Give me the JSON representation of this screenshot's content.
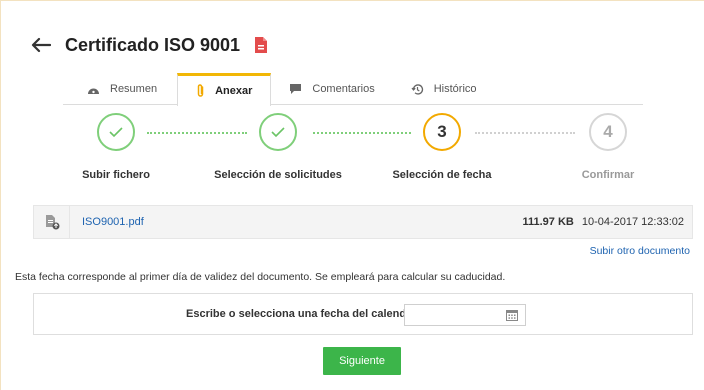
{
  "header": {
    "title": "Certificado ISO 9001",
    "back_icon": "arrow-left-icon",
    "doc_icon": "pdf-file-icon"
  },
  "tabs": [
    {
      "label": "Resumen",
      "icon": "dashboard-icon",
      "active": false
    },
    {
      "label": "Anexar",
      "icon": "paperclip-icon",
      "active": true
    },
    {
      "label": "Comentarios",
      "icon": "comment-icon",
      "active": false
    },
    {
      "label": "Histórico",
      "icon": "history-icon",
      "active": false
    }
  ],
  "stepper": {
    "steps": [
      {
        "number": "1",
        "label": "Subir fichero",
        "state": "done"
      },
      {
        "number": "2",
        "label": "Selección de solicitudes",
        "state": "done"
      },
      {
        "number": "3",
        "label": "Selección de fecha",
        "state": "current"
      },
      {
        "number": "4",
        "label": "Confirmar",
        "state": "future"
      }
    ]
  },
  "file": {
    "name": "ISO9001.pdf",
    "size": "111.97 KB",
    "date": "10-04-2017 12:33:02",
    "icon": "file-upload-icon"
  },
  "upload_other_label": "Subir otro documento",
  "info_text": "Esta fecha corresponde al primer día de validez del documento. Se empleará para calcular su caducidad.",
  "date_picker": {
    "label": "Escribe o selecciona una fecha del calendario",
    "value": "",
    "icon": "calendar-icon"
  },
  "next_button_label": "Siguiente",
  "colors": {
    "accent": "#f2b705",
    "done": "#7fcf7a",
    "link": "#1e63b0",
    "primary_button": "#3cb54a"
  }
}
